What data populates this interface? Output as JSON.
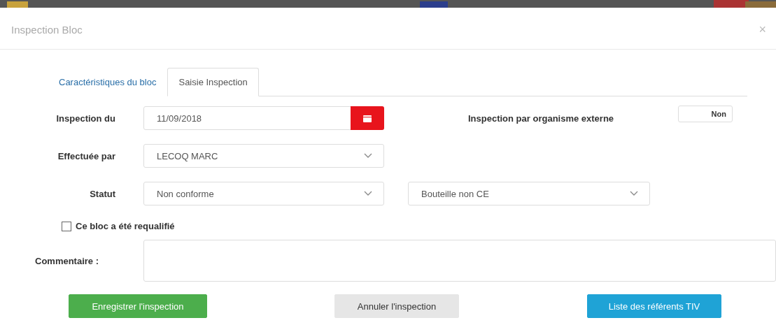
{
  "modal": {
    "title": "Inspection Bloc",
    "close": "×"
  },
  "tabs": [
    {
      "label": "Caractéristiques du bloc",
      "selected": false
    },
    {
      "label": "Saisie Inspection",
      "selected": true
    }
  ],
  "form": {
    "date": {
      "label": "Inspection du",
      "value": "11/09/2018"
    },
    "external": {
      "label": "Inspection par organisme externe",
      "toggle": {
        "label": "Non",
        "on": false
      }
    },
    "performed_by": {
      "label": "Effectuée par",
      "value": "LECOQ MARC"
    },
    "status": {
      "label": "Statut",
      "value": "Non conforme",
      "detail": "Bouteille non CE"
    },
    "requalified": {
      "label": "Ce bloc a été requalifié",
      "checked": false
    },
    "comment": {
      "label": "Commentaire :"
    }
  },
  "buttons": [
    {
      "label": "Enregistrer l'inspection",
      "kind": "success"
    },
    {
      "label": "Annuler l'inspection",
      "kind": "default"
    },
    {
      "label": "Liste des référents TIV",
      "kind": "info"
    }
  ]
}
